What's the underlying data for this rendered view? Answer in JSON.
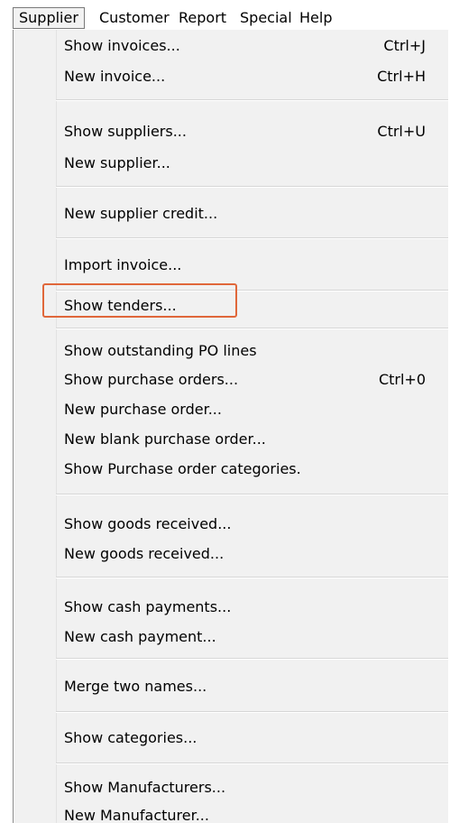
{
  "menubar": {
    "items": [
      "Supplier",
      "Customer",
      "Report",
      "Special",
      "Help"
    ]
  },
  "dropdown": {
    "items": [
      {
        "label": "Show invoices...",
        "shortcut": "Ctrl+J"
      },
      {
        "label": "New invoice...",
        "shortcut": "Ctrl+H"
      },
      {
        "label": "Show suppliers...",
        "shortcut": "Ctrl+U"
      },
      {
        "label": "New supplier...",
        "shortcut": ""
      },
      {
        "label": "New supplier credit...",
        "shortcut": ""
      },
      {
        "label": "Import invoice...",
        "shortcut": ""
      },
      {
        "label": "Show tenders...",
        "shortcut": ""
      },
      {
        "label": "Show outstanding PO lines",
        "shortcut": ""
      },
      {
        "label": "Show purchase orders...",
        "shortcut": "Ctrl+0"
      },
      {
        "label": "New purchase order...",
        "shortcut": ""
      },
      {
        "label": "New blank purchase order...",
        "shortcut": ""
      },
      {
        "label": "Show Purchase order categories.",
        "shortcut": ""
      },
      {
        "label": "Show goods received...",
        "shortcut": ""
      },
      {
        "label": "New goods received...",
        "shortcut": ""
      },
      {
        "label": "Show cash payments...",
        "shortcut": ""
      },
      {
        "label": "New cash payment...",
        "shortcut": ""
      },
      {
        "label": "Merge two names...",
        "shortcut": ""
      },
      {
        "label": "Show categories...",
        "shortcut": ""
      },
      {
        "label": "Show Manufacturers...",
        "shortcut": ""
      },
      {
        "label": "New Manufacturer...",
        "shortcut": ""
      }
    ]
  },
  "colors": {
    "highlight_border": "#e0673a",
    "menu_background": "#f1f1f1"
  }
}
